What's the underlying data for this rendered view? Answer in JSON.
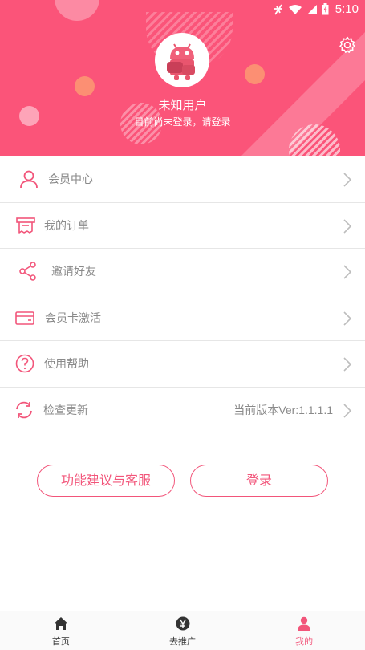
{
  "status_bar": {
    "time": "5:10"
  },
  "profile": {
    "username": "未知用户",
    "login_hint": "目前尚未登录，请登录"
  },
  "menu": [
    {
      "label": "会员中心",
      "icon": "user-icon",
      "value": ""
    },
    {
      "label": "我的订单",
      "icon": "receipt-icon",
      "value": ""
    },
    {
      "label": "邀请好友",
      "icon": "share-icon",
      "value": ""
    },
    {
      "label": "会员卡激活",
      "icon": "card-icon",
      "value": ""
    },
    {
      "label": "使用帮助",
      "icon": "help-icon",
      "value": ""
    },
    {
      "label": "检查更新",
      "icon": "refresh-icon",
      "value": "当前版本Ver:1.1.1.1"
    }
  ],
  "buttons": {
    "feedback": "功能建议与客服",
    "login": "登录"
  },
  "bottom_nav": [
    {
      "label": "首页",
      "icon": "home-icon",
      "active": false
    },
    {
      "label": "去推广",
      "icon": "yen-icon",
      "active": false
    },
    {
      "label": "我的",
      "icon": "person-icon",
      "active": true
    }
  ],
  "colors": {
    "accent": "#fb5479",
    "text_muted": "#8a8a8a"
  }
}
